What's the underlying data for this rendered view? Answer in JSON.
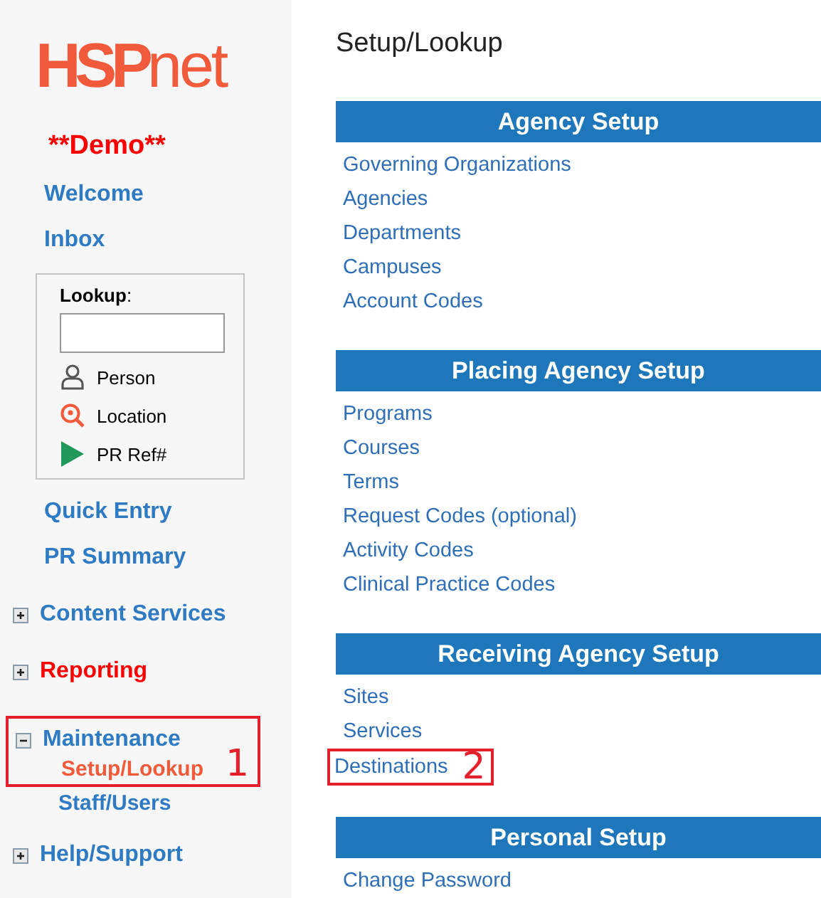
{
  "sidebar": {
    "logo": {
      "main": "HSP",
      "suffix": "net"
    },
    "demo_label": "**Demo**",
    "top_links": [
      {
        "label": "Welcome"
      },
      {
        "label": "Inbox"
      }
    ],
    "lookup": {
      "label": "**Lookup**:",
      "options": [
        {
          "kind": "person",
          "label": "Person"
        },
        {
          "kind": "location",
          "label": "Location"
        },
        {
          "kind": "reference",
          "label": "PR Ref#"
        }
      ]
    },
    "links": [
      {
        "label": "Quick Entry"
      },
      {
        "label": "PR Summary"
      }
    ],
    "groups": [
      {
        "label": "Content Services",
        "expanded": false,
        "highlighted": false
      },
      {
        "label": "Reporting",
        "expanded": false,
        "highlighted": true
      },
      {
        "label": "Maintenance",
        "expanded": true,
        "highlighted": false,
        "callout": "1",
        "children": [
          {
            "label": "Setup/Lookup",
            "selected": true
          },
          {
            "label": "Staff/Users",
            "selected": false
          }
        ]
      },
      {
        "label": "Help/Support",
        "expanded": false,
        "highlighted": false
      }
    ]
  },
  "page_title": "Setup/Lookup",
  "sections": [
    {
      "title": "Agency Setup",
      "links": [
        {
          "label": "Governing Organizations"
        },
        {
          "label": "Agencies"
        },
        {
          "label": "Departments"
        },
        {
          "label": "Campuses"
        },
        {
          "label": "Account Codes"
        }
      ]
    },
    {
      "title": "Placing Agency Setup",
      "links": [
        {
          "label": "Programs"
        },
        {
          "label": "Courses"
        },
        {
          "label": "Terms"
        },
        {
          "label": "Request Codes (optional)"
        },
        {
          "label": "Activity Codes"
        },
        {
          "label": "Clinical Practice Codes"
        }
      ]
    },
    {
      "title": "Receiving Agency Setup",
      "links": [
        {
          "label": "Sites"
        },
        {
          "label": "Services"
        },
        {
          "label": "Destinations",
          "callout": "2"
        }
      ]
    },
    {
      "title": "Personal Setup",
      "links": [
        {
          "label": "Change Password"
        }
      ]
    }
  ]
}
